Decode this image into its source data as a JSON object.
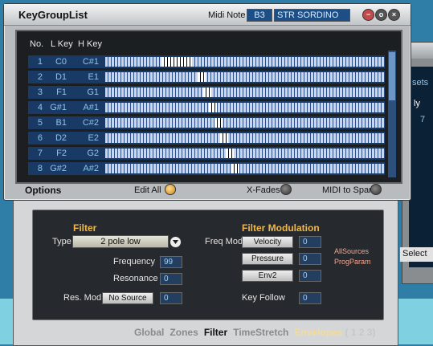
{
  "colors": {
    "accent_orange": "#f0b84a",
    "key_blue": "#8fc2ee",
    "row_blue": "#1a3a66",
    "bg_blue": "#2f7ea8"
  },
  "window": {
    "title": "KeyGroupList",
    "midi_note_label": "Midi Note",
    "midi_note_value": "B3",
    "program_name": "STR SORDINO",
    "controls": [
      "minimize-icon",
      "restore-icon",
      "close-icon"
    ]
  },
  "table": {
    "headers": {
      "no": "No.",
      "lkey": "L Key",
      "hkey": "H Key"
    },
    "rows": [
      {
        "no": "1",
        "lkey": "C0",
        "hkey": "C#1"
      },
      {
        "no": "2",
        "lkey": "D1",
        "hkey": "E1"
      },
      {
        "no": "3",
        "lkey": "F1",
        "hkey": "G1"
      },
      {
        "no": "4",
        "lkey": "G#1",
        "hkey": "A#1"
      },
      {
        "no": "5",
        "lkey": "B1",
        "hkey": "C#2"
      },
      {
        "no": "6",
        "lkey": "D2",
        "hkey": "E2"
      },
      {
        "no": "7",
        "lkey": "F2",
        "hkey": "G2"
      },
      {
        "no": "8",
        "lkey": "G#2",
        "hkey": "A#2"
      }
    ]
  },
  "footer": {
    "options": "Options",
    "edit_all": "Edit All",
    "xfades": "X-Fades",
    "midi_to_span": "MIDI to Span"
  },
  "filter": {
    "title": "Filter",
    "type_label": "Type",
    "type_value": "2 pole low",
    "frequency_label": "Frequency",
    "frequency_value": "99",
    "resonance_label": "Resonance",
    "resonance_value": "0",
    "resmod_label": "Res. Mod.",
    "resmod_source": "No Source",
    "resmod_value": "0"
  },
  "filter_mod": {
    "title": "Filter Modulation",
    "freqmod_label": "Freq Mod",
    "sources": [
      {
        "label": "Velocity",
        "value": "0"
      },
      {
        "label": "Pressure",
        "value": "0"
      },
      {
        "label": "Env2",
        "value": "0"
      }
    ],
    "allsources": "AllSources",
    "progparam": "ProgParam",
    "keyfollow_label": "Key Follow",
    "keyfollow_value": "0"
  },
  "tabs": {
    "global": "Global",
    "zones": "Zones",
    "filter": "Filter",
    "timestretch": "TimeStretch",
    "envelopes": "Envelopes",
    "env_nums": "( 1 2 3)"
  },
  "background": {
    "sets": "sets",
    "ly": "ly",
    "seven": "7",
    "select": "Select"
  }
}
